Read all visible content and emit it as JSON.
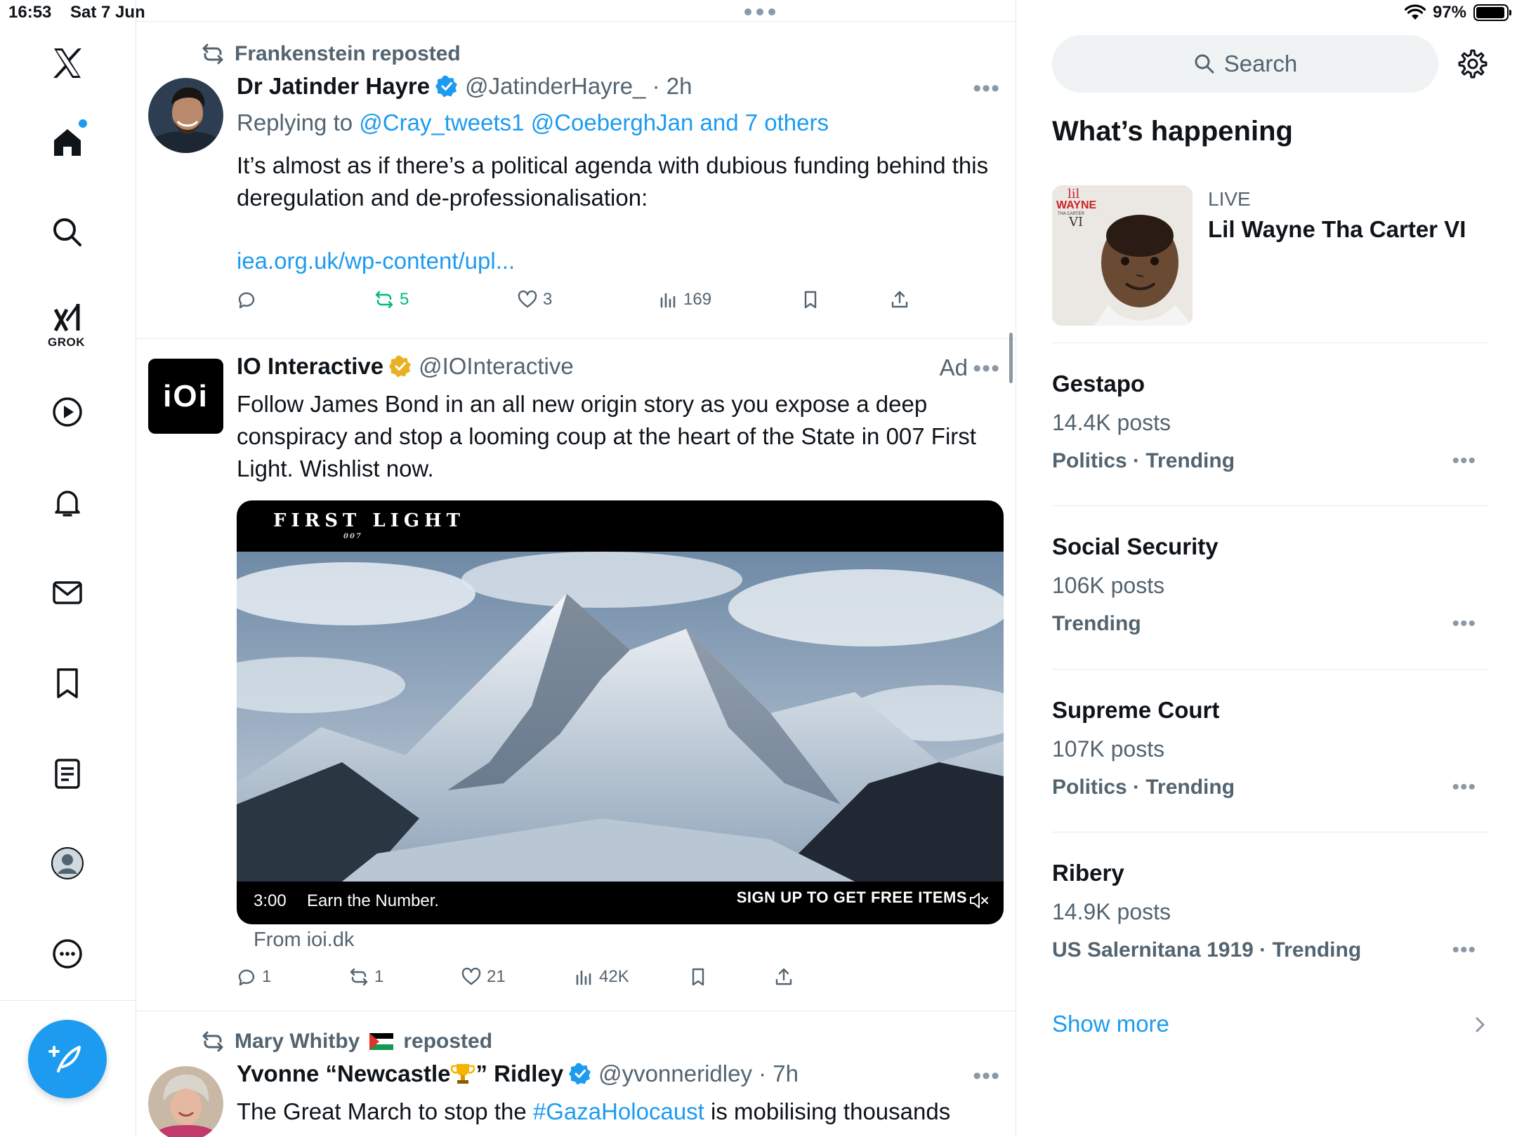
{
  "status_bar": {
    "time": "16:53",
    "date": "Sat 7 Jun",
    "battery": "97%"
  },
  "nav": {
    "grok_label": "GROK",
    "items": [
      "home",
      "explore",
      "grok",
      "videos",
      "notifications",
      "messages",
      "bookmarks",
      "lists",
      "profile",
      "more"
    ]
  },
  "tweets": [
    {
      "context": "Frankenstein reposted",
      "name": "Dr Jatinder Hayre",
      "handle": "@JatinderHayre_ · 2h",
      "reply_prefix": "Replying to ",
      "reply_targets": "@Cray_tweets1 @CoeberghJan and 7 others",
      "text": "It’s almost as if there’s a political agenda with dubious funding behind this deregulation and de-professionalisation:",
      "link": "iea.org.uk/wp-content/upl...",
      "actions": {
        "replies": "",
        "reposts": "5",
        "likes": "3",
        "views": "169"
      }
    },
    {
      "name": "IO Interactive",
      "handle": "@IOInteractive",
      "ad_label": "Ad",
      "logo_text": "iOi",
      "text": "Follow James Bond in an all new origin story as you expose a deep conspiracy and stop a looming coup at the heart of the State in 007 First Light. Wishlist now.",
      "video": {
        "brand": "FIRST LIGHT",
        "brand_sub": "007",
        "duration": "3:00",
        "caption": "Earn the Number.",
        "cta": "SIGN UP TO GET FREE ITEMS"
      },
      "from": "From ioi.dk",
      "actions": {
        "replies": "1",
        "reposts": "1",
        "likes": "21",
        "views": "42K"
      }
    },
    {
      "context_name": "Mary Whitby",
      "context_suffix": "reposted",
      "name_prefix": "Yvonne “Newcastle ",
      "name_suffix": "” Ridley",
      "handle": "@yvonneridley · 7h",
      "text_prefix": "The Great March to stop the ",
      "hashtag": "#GazaHolocaust",
      "text_suffix": " is mobilising thousands"
    }
  ],
  "sidebar": {
    "search_placeholder": "Search",
    "title": "What’s happening",
    "live": {
      "label": "LIVE",
      "title": "Lil Wayne Tha Carter VI",
      "album_text": [
        "lil",
        "WAYNE",
        "THA CARTER",
        "VI"
      ]
    },
    "trends": [
      {
        "name": "Gestapo",
        "count": "14.4K posts",
        "category": "Politics · Trending"
      },
      {
        "name": "Social Security",
        "count": "106K posts",
        "category": "Trending"
      },
      {
        "name": "Supreme Court",
        "count": "107K posts",
        "category": "Politics · Trending"
      },
      {
        "name": "Ribery",
        "count": "14.9K posts",
        "category": "US Salernitana 1919 · Trending"
      }
    ],
    "show_more": "Show more"
  },
  "colors": {
    "accent": "#1d9bf0",
    "repost_green": "#00ba7c",
    "muted": "#536471",
    "verified_gold": "#e8b023"
  }
}
